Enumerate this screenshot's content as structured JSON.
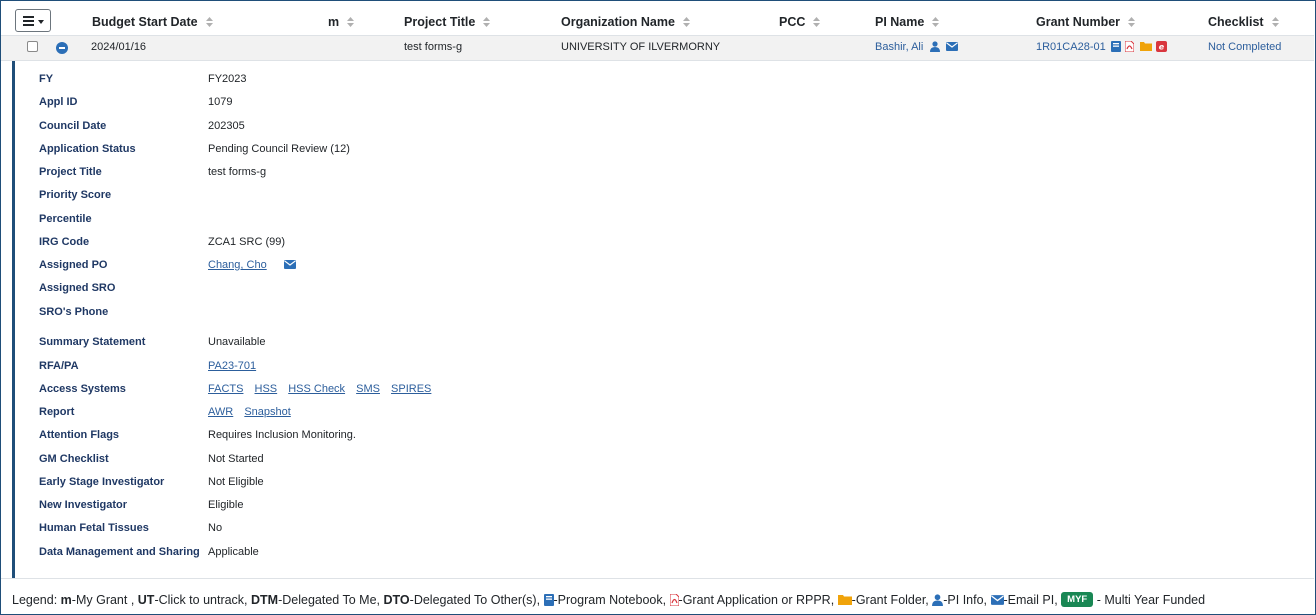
{
  "columns": {
    "budget_start_date": "Budget Start Date",
    "m": "m",
    "project_title": "Project Title",
    "organization_name": "Organization Name",
    "pcc": "PCC",
    "pi_name": "PI Name",
    "grant_number": "Grant Number",
    "checklist": "Checklist"
  },
  "row": {
    "budget_start_date": "2024/01/16",
    "m": "",
    "project_title": "test forms-g",
    "organization_name": "UNIVERSITY OF ILVERMORNY",
    "pcc": "",
    "pi_name": "Bashir, Ali",
    "grant_number": "1R01CA28-01",
    "checklist": "Not Completed"
  },
  "details": {
    "fy": {
      "label": "FY",
      "value": "FY2023"
    },
    "appl_id": {
      "label": "Appl ID",
      "value": "1079"
    },
    "council_date": {
      "label": "Council Date",
      "value": "202305"
    },
    "application_status": {
      "label": "Application Status",
      "value": "Pending Council Review (12)"
    },
    "project_title": {
      "label": "Project Title",
      "value": "test forms-g"
    },
    "priority_score": {
      "label": "Priority Score",
      "value": ""
    },
    "percentile": {
      "label": "Percentile",
      "value": ""
    },
    "irg_code": {
      "label": "IRG Code",
      "value": "ZCA1 SRC (99)"
    },
    "assigned_po": {
      "label": "Assigned PO",
      "value": "Chang, Cho"
    },
    "assigned_sro": {
      "label": "Assigned SRO",
      "value": ""
    },
    "sro_phone": {
      "label": "SRO's Phone",
      "value": ""
    },
    "summary_statement": {
      "label": "Summary Statement",
      "value": "Unavailable"
    },
    "rfa_pa": {
      "label": "RFA/PA",
      "value": "PA23-701"
    },
    "access_systems": {
      "label": "Access Systems",
      "links": [
        "FACTS",
        "HSS",
        "HSS Check",
        "SMS",
        "SPIRES"
      ]
    },
    "report": {
      "label": "Report",
      "links": [
        "AWR",
        "Snapshot"
      ]
    },
    "attention_flags": {
      "label": "Attention Flags",
      "value": "Requires Inclusion Monitoring."
    },
    "gm_checklist": {
      "label": "GM Checklist",
      "value": "Not Started"
    },
    "early_stage_investigator": {
      "label": "Early Stage Investigator",
      "value": "Not Eligible"
    },
    "new_investigator": {
      "label": "New Investigator",
      "value": "Eligible"
    },
    "human_fetal_tissues": {
      "label": "Human Fetal Tissues",
      "value": "No"
    },
    "data_management_sharing": {
      "label": "Data Management and Sharing",
      "value": "Applicable"
    }
  },
  "legend": {
    "prefix": "Legend: ",
    "m_key": "m",
    "m_desc": "-My Grant , ",
    "ut_key": "UT",
    "ut_desc": "-Click to untrack, ",
    "dtm_key": "DTM",
    "dtm_desc": "-Delegated To Me, ",
    "dto_key": "DTO",
    "dto_desc": "-Delegated To Other(s), ",
    "notebook_desc": "-Program Notebook, ",
    "application_desc": "-Grant Application or RPPR, ",
    "folder_desc": "-Grant Folder, ",
    "pi_info_desc": "-PI Info, ",
    "email_desc": "-Email PI, ",
    "myf_badge": "MYF",
    "myf_desc": " - Multi Year Funded"
  },
  "icons": {
    "menu": "hamburger-icon",
    "collapse": "minus-circle-icon",
    "person": "person-icon",
    "email": "envelope-icon",
    "notebook": "book-icon",
    "pdf": "pdf-icon",
    "folder": "folder-icon",
    "eapp": "e-icon"
  },
  "colors": {
    "accent": "#2c5e9c",
    "label": "#1f3864",
    "myf": "#198754",
    "pdf": "#d9363e",
    "folder": "#f0a30a"
  }
}
